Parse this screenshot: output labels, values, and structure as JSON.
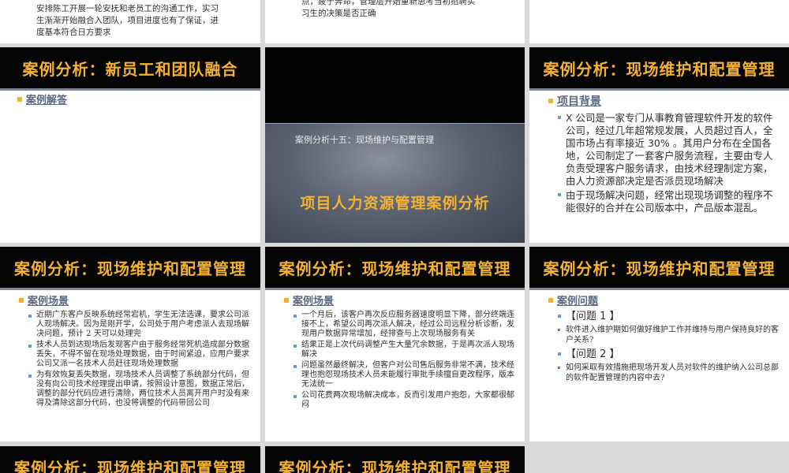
{
  "slide_top_left": {
    "lines": [
      "安排陈工开展一轮安抚和老员工的沟通工作，实习",
      "生渐渐开始融合入团队，项目进度也有了保证，进",
      "度基本符合日方要求"
    ]
  },
  "slide_top_middle": {
    "lines": [
      "点，疲于奔命，管理层开始重新思考当初招聘实",
      "习生的决策是否正确"
    ]
  },
  "slide_team_fusion": {
    "title": "案例分析：新员工和团队融合",
    "heading": "案例解答"
  },
  "slide_cover": {
    "subtitle": "案例分析十五：现场维护与配置管理",
    "title": "项目人力资源管理案例分析"
  },
  "slide_background": {
    "title": "案例分析：现场维护和配置管理",
    "heading": "项目背景",
    "bullets": [
      "X 公司是一家专门从事教育管理软件开发的软件公司，经过几年超常规发展，人员超过百人，全国市场占有率接近 30% 。其用户分布在全国各地，公司制定了一套客户服务流程，主要由专人负责受理客户服务请求，由技术经理制定方案，由人力资源部决定是否派员现场解决",
      "由于现场解决问题，经常出现现场调整的程序不能很好的合并在公司版本中，产品版本混乱。"
    ]
  },
  "slide_scene_1": {
    "title": "案例分析：现场维护和配置管理",
    "heading": "案例场景",
    "bullets": [
      "近期广东客户反映系统经常宕机，学生无法选课，要求公司派人现场解决。因为是刚开学，公司处于用户考虑派人去现场解决问题，预计 2 天可以处理完",
      "技术人员到达现场后发现客户由于服务经常死机造成部分数据丢失，不得不留在现场处理数据，由于时间紧迫，应用户要求公司又派一名技术人员赶往现场处理数据",
      "为有效恢复丢失数据，现场技术人员调整了系统部分代码，但没有向公司技术经理提出申请，按照设计意图，数据正常后，调整的部分代码应进行清除，两位技术人员离开用户时没有来得及清除这部分代码，也没将调整的代码带回公司"
    ]
  },
  "slide_scene_2": {
    "title": "案例分析：现场维护和配置管理",
    "heading": "案例场景",
    "bullets": [
      "一个月后，该客户再次反应服务器速度明显下降，部分终端连接不上，希望公司再次派人解决，经过公司远程分析诊断，发现用户数据异常增加，经排查与上次现场服务有关",
      "结果正是上次代码调整产生大量冗余数据，于是再次派人现场解决",
      "问题虽然最终解决，但客户对公司售后服务非常不满，技术经理也抱怨现场技术人员未能履行审批手续擅自更改程序，版本无法统一",
      "公司花费两次现场解决成本，反而引发用户抱怨，大家都很郁闷"
    ]
  },
  "slide_questions": {
    "title": "案例分析：现场维护和配置管理",
    "heading": "案例问题",
    "q1_label": "【问题 1 】",
    "q1_text": "软件进入维护期如何做好维护工作并维持与用户保持良好的客户关系?",
    "q2_label": "【问题 2 】",
    "q2_text": "如何采取有效措施把现场开发人员对软件的维护纳入公司总部的软件配置管理的内容中去?"
  },
  "slide_bottom_left": {
    "title": "案例分析：现场维护和配置管理"
  },
  "slide_bottom_middle": {
    "title": "案例分析：现场维护和配置管理"
  },
  "colors": {
    "title_gold": "#f3b234",
    "bar_black": "#050505",
    "heading_blue": "#5a6a82"
  }
}
